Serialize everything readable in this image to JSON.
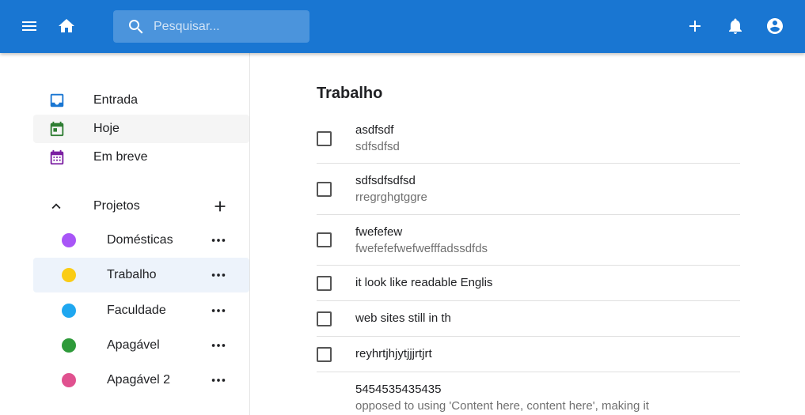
{
  "header": {
    "search_placeholder": "Pesquisar...",
    "accent_color": "#1976d2"
  },
  "sidebar": {
    "nav": [
      {
        "label": "Entrada",
        "icon": "inbox-icon",
        "color": "#1976d2"
      },
      {
        "label": "Hoje",
        "icon": "calendar-today-icon",
        "color": "#2e7d32",
        "active": true
      },
      {
        "label": "Em breve",
        "icon": "calendar-month-icon",
        "color": "#7b1fa2"
      }
    ],
    "projects_label": "Projetos",
    "projects": [
      {
        "label": "Domésticas",
        "color": "#a855f7"
      },
      {
        "label": "Trabalho",
        "color": "#facc15",
        "active": true
      },
      {
        "label": "Faculdade",
        "color": "#1fa7f0"
      },
      {
        "label": "Apagável",
        "color": "#2e9a3a"
      },
      {
        "label": "Apagável 2",
        "color": "#e0518f"
      }
    ]
  },
  "main": {
    "title": "Trabalho",
    "tasks": [
      {
        "title": "asdfsdf",
        "description": "sdfsdfsd"
      },
      {
        "title": "sdfsdfsdfsd",
        "description": "rregrghgtggre"
      },
      {
        "title": "fwefefew",
        "description": "fwefefefwefwefffadssdfds"
      },
      {
        "title": "it look like readable Englis",
        "description": ""
      },
      {
        "title": "web sites still in th",
        "description": ""
      },
      {
        "title": "reyhrtjhjytjjjrtjrt",
        "description": ""
      },
      {
        "title": "5454535435435",
        "description": "opposed to using 'Content here, content here', making it"
      }
    ]
  }
}
